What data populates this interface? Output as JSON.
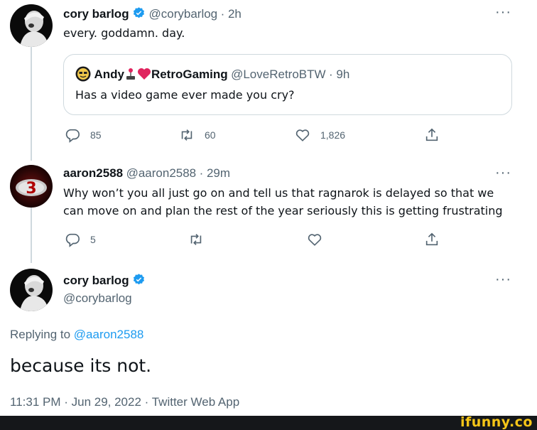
{
  "tweet1": {
    "display_name": "cory barlog",
    "handle": "@corybarlog",
    "time": "· 2h",
    "text": "every. goddamn. day.",
    "quote": {
      "display_name_prefix": "Andy",
      "display_name_suffix": "RetroGaming",
      "handle": "@LoveRetroBTW",
      "time": "· 9h",
      "text": "Has a video game ever made you cry?"
    },
    "actions": {
      "replies": "85",
      "retweets": "60",
      "likes": "1,826"
    }
  },
  "tweet2": {
    "display_name": "aaron2588",
    "handle": "@aaron2588",
    "time": "· 29m",
    "text_line1": "Why won’t you all just go on and tell us that ragnarok is delayed so that we",
    "text_line2": "can move on and plan the rest of the year seriously this is getting frustrating",
    "actions": {
      "replies": "5"
    }
  },
  "main_tweet": {
    "display_name": "cory barlog",
    "handle": "@corybarlog",
    "replying_to_label": "Replying to",
    "replying_to_handle": "@aaron2588",
    "text": "because its not.",
    "meta": "11:31 PM · Jun 29, 2022 · Twitter Web App"
  },
  "more_label": "···",
  "watermark": "ifunny.co",
  "colors": {
    "accent": "#1d9bf0",
    "muted": "#536471",
    "heart": "#e0245e",
    "watermark": "#f5c518"
  }
}
